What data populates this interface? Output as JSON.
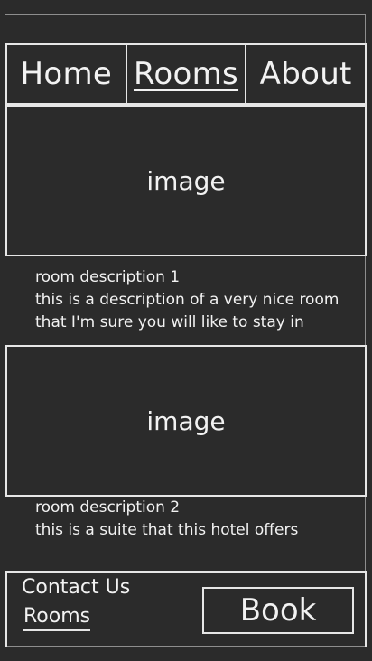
{
  "nav": {
    "items": [
      {
        "label": "Home"
      },
      {
        "label": "Rooms"
      },
      {
        "label": "About"
      }
    ]
  },
  "rooms": [
    {
      "image_label": "image",
      "title": "room description 1",
      "lines": [
        "this is a description of a very nice room",
        "that I'm sure you will like to stay in"
      ]
    },
    {
      "image_label": "image",
      "title": "room description 2",
      "lines": [
        "this is a suite that this hotel offers"
      ]
    }
  ],
  "footer": {
    "contact_label": "Contact Us",
    "rooms_label": "Rooms",
    "book_label": "Book"
  }
}
